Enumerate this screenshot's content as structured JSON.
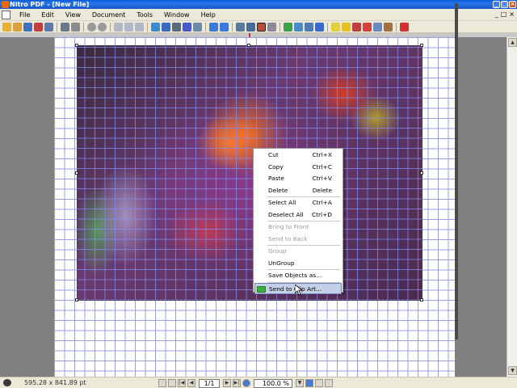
{
  "window": {
    "title": "Nitro PDF - [New File]",
    "minimize": "_",
    "maximize": "□",
    "close": "×"
  },
  "menubar": {
    "items": [
      "File",
      "Edit",
      "View",
      "Document",
      "Tools",
      "Window",
      "Help"
    ],
    "mdi": [
      "_",
      "□",
      "×"
    ]
  },
  "context_menu": {
    "items": [
      {
        "label": "Cut",
        "shortcut": "Ctrl+X",
        "enabled": true
      },
      {
        "label": "Copy",
        "shortcut": "Ctrl+C",
        "enabled": true
      },
      {
        "label": "Paste",
        "shortcut": "Ctrl+V",
        "enabled": true
      },
      {
        "label": "Delete",
        "shortcut": "Delete",
        "enabled": true
      },
      {
        "label": "Select All",
        "shortcut": "Ctrl+A",
        "enabled": true
      },
      {
        "label": "Deselect All",
        "shortcut": "Ctrl+D",
        "enabled": true
      },
      {
        "label": "Bring to Front",
        "shortcut": "",
        "enabled": false
      },
      {
        "label": "Send to Back",
        "shortcut": "",
        "enabled": false
      },
      {
        "label": "Group",
        "shortcut": "",
        "enabled": false
      },
      {
        "label": "UnGroup",
        "shortcut": "",
        "enabled": true
      },
      {
        "label": "Save Objects as...",
        "shortcut": "",
        "enabled": true
      },
      {
        "label": "Send to Clip Art...",
        "shortcut": "",
        "enabled": true,
        "highlighted": true
      }
    ]
  },
  "statusbar": {
    "dimensions": "595.28 x 841.89 pt",
    "page_current": "1/1",
    "zoom": "100.0 %"
  },
  "colors": {
    "titlebar": "#1556c9",
    "chrome": "#ece9d8",
    "grid": "#9a9ee6",
    "menu_highlight": "#c4cfe8"
  }
}
